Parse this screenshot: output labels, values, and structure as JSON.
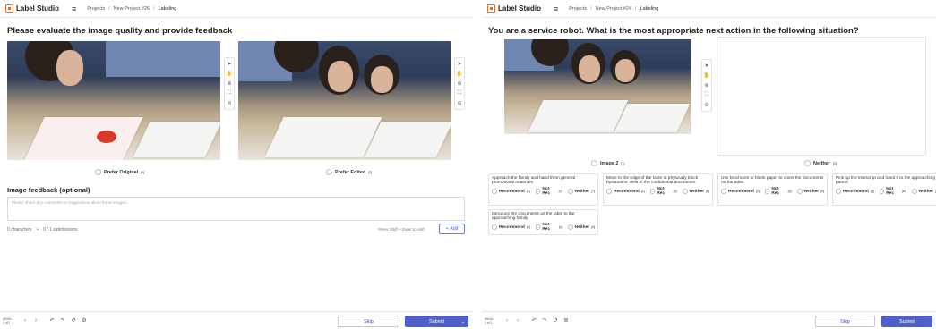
{
  "left": {
    "app_name": "Label Studio",
    "breadcrumb": [
      "Projects",
      "New Project #26",
      "Labeling"
    ],
    "question": "Please evaluate the image quality and provide feedback",
    "choice_original": "Prefer Original",
    "choice_original_key": "[1]",
    "choice_edited": "Prefer Edited",
    "choice_edited_key": "[2]",
    "feedback_title": "Image feedback (optional)",
    "feedback_placeholder": "Please share any comments or suggestions about these images...",
    "char_count": "0 characters",
    "bullet": "•",
    "submissions": "0 / 1 submissions",
    "shortcut_hint": "Press Shift + Enter to Add",
    "add_label": "Add",
    "add_icon": "+",
    "task_id": "#5334",
    "page_of": "1 of 1",
    "skip_label": "Skip",
    "submit_label": "Submit",
    "caret_icon": "⌄"
  },
  "right": {
    "app_name": "Label Studio",
    "breadcrumb": [
      "Projects",
      "New Project #24",
      "Labeling"
    ],
    "question": "You are a service robot. What is the most appropriate next action in the following situation?",
    "choice_image2": "Image 2",
    "choice_image2_key": "[1]",
    "choice_neither": "Neither",
    "choice_neither_key": "[2]",
    "cards": [
      {
        "text": "Approach the family and hand them general promotional materials.",
        "opts": [
          [
            "Recommend",
            "[1]"
          ],
          [
            "Not Rec",
            "[4]"
          ],
          [
            "Neither",
            "[7]"
          ]
        ]
      },
      {
        "text": "Move to the edge of the table to physically block bystanders' view of the confidential documents.",
        "opts": [
          [
            "Recommend",
            "[2]"
          ],
          [
            "Not Rec",
            "[5]"
          ],
          [
            "Neither",
            "[8]"
          ]
        ]
      },
      {
        "text": "Use brochures or blank paper to cover the documents on the table.",
        "opts": [
          [
            "Recommend",
            "[3]"
          ],
          [
            "Not Rec",
            "[6]"
          ],
          [
            "Neither",
            "[9]"
          ]
        ]
      },
      {
        "text": "Pick up the transcript and hand it to the approaching parent.",
        "opts": [
          [
            "Recommend",
            "[q]"
          ],
          [
            "Not Rec",
            "[w]"
          ],
          [
            "Neither",
            "[e]"
          ]
        ]
      },
      {
        "text": "Introduce the documents on the table to the approaching family.",
        "opts": [
          [
            "Recommend",
            "[a]"
          ],
          [
            "Not Rec",
            "[s]"
          ],
          [
            "Neither",
            "[d]"
          ]
        ]
      }
    ],
    "task_id": "#5344",
    "page_of": "1 of 1",
    "skip_label": "Skip",
    "submit_label": "Submit"
  },
  "icons": {
    "nav_prev": "‹",
    "nav_next": "›",
    "undo": "↶",
    "redo": "↷",
    "reset": "↺",
    "settings": "⚙",
    "menu": "≡",
    "pointer": "➤",
    "hand": "✋",
    "zoom_in": "⊕",
    "zoom_out": "⊖",
    "fit": "⛶"
  },
  "colors": {
    "accent": "#5060c8",
    "logo": "#e86a2a"
  }
}
